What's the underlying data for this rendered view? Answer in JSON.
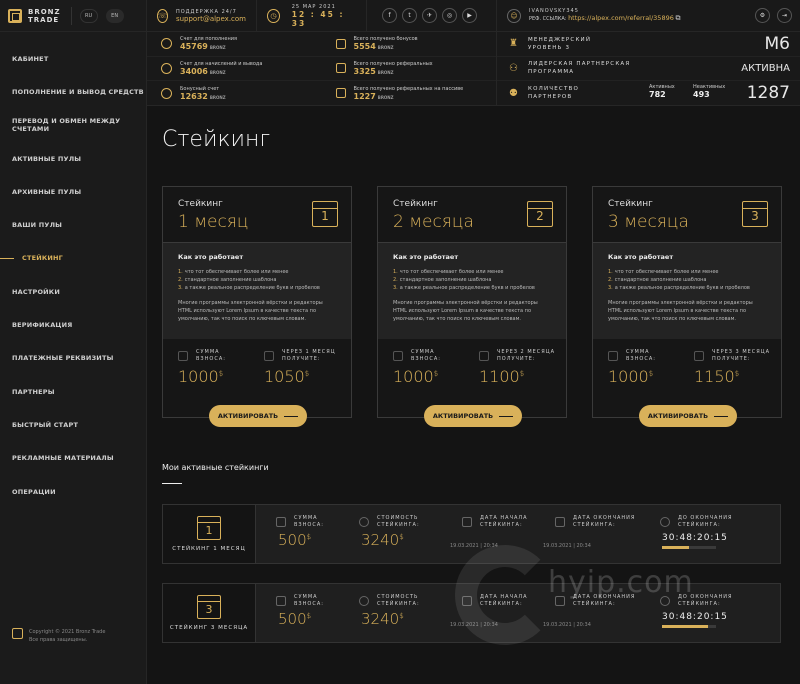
{
  "brand": {
    "line1": "BRONZ",
    "line2": "TRADE"
  },
  "lang": {
    "ru": "RU",
    "en": "EN"
  },
  "menu": [
    "КАБИНЕТ",
    "ПОПОЛНЕНИЕ И ВЫВОД СРЕДСТВ",
    "ПЕРЕВОД И ОБМЕН МЕЖДУ СЧЕТАМИ",
    "АКТИВНЫЕ ПУЛЫ",
    "АРХИВНЫЕ ПУЛЫ",
    "ВАШИ ПУЛЫ",
    "СТЕЙКИНГ",
    "НАСТРОЙКИ",
    "ВЕРИФИКАЦИЯ",
    "ПЛАТЕЖНЫЕ РЕКВИЗИТЫ",
    "ПАРТНЕРЫ",
    "БЫСТРЫЙ СТАРТ",
    "РЕКЛАМНЫЕ МАТЕРИАЛЫ",
    "ОПЕРАЦИИ"
  ],
  "copyright": {
    "line1": "Copyright © 2021 Bronz Trade",
    "line2": "Все права защищены."
  },
  "header": {
    "support_label": "ПОДДЕРЖКА 24/7",
    "support_email": "support@alpex.com",
    "date": "25 МАР 2021",
    "time": "12 : 45 : 33",
    "social": [
      "f",
      "t",
      "✈",
      "◎",
      "▶"
    ],
    "username": "IVANOVSKY345",
    "ref_label": "РЕФ. ССЫЛКА:",
    "ref_link": "https://alpex.com/referral/35896"
  },
  "balances": [
    {
      "label": "Счет для пополнения",
      "value": "45769",
      "unit": "BRONZ"
    },
    {
      "label": "Всего получено бонусов",
      "value": "5554",
      "unit": "BRONZ"
    },
    {
      "label": "Счет для начислений и вывода",
      "value": "34006",
      "unit": "BRONZ"
    },
    {
      "label": "Всего получено реферальных",
      "value": "3325",
      "unit": "BRONZ"
    },
    {
      "label": "Бонусный счет",
      "value": "12632",
      "unit": "BRONZ"
    },
    {
      "label": "Всего получено реферальных на пассиве",
      "value": "1227",
      "unit": "BRONZ"
    }
  ],
  "status": {
    "manager_level_l1": "МЕНЕДЖЕРСКИЙ",
    "manager_level_l2": "УРОВЕНЬ 3",
    "manager_value": "M6",
    "leader_l1": "ЛИДЕРСКАЯ ПАРТНЕРСКАЯ",
    "leader_l2": "ПРОГРАММА",
    "leader_value": "АКТИВНА",
    "partners_l1": "КОЛИЧЕСТВО",
    "partners_l2": "ПАРТНЕРОВ",
    "active_label": "Активных",
    "active_value": "782",
    "inactive_label": "Неактивных",
    "inactive_value": "493",
    "total_value": "1287"
  },
  "page": {
    "title": "Стейкинг",
    "section_title": "Мои активные стейкинги"
  },
  "cards": [
    {
      "kicker": "Стейкинг",
      "months": "1 месяц",
      "num": "1",
      "how_title": "Как это работает",
      "points": [
        "что тот обеспечивает более или менее",
        "стандартное заполнение шаблона",
        "а также реальное распределение букв и пробелов"
      ],
      "text": "Многие программы электронной вёрстки и редакторы HTML используют Lorem Ipsum в качестве текста по умолчанию, так что поиск по ключевым словам.",
      "sum_label_l1": "СУММА",
      "sum_label_l2": "ВЗНОСА:",
      "sum_value": "1000",
      "get_label_l1": "ЧЕРЕЗ 1 МЕСЯЦ",
      "get_label_l2": "ПОЛУЧИТЕ:",
      "get_value": "1050",
      "currency": "$",
      "button": "АКТИВИРОВАТЬ"
    },
    {
      "kicker": "Стейкинг",
      "months": "2 месяца",
      "num": "2",
      "how_title": "Как это работает",
      "points": [
        "что тот обеспечивает более или менее",
        "стандартное заполнение шаблона",
        "а также реальное распределение букв и пробелов"
      ],
      "text": "Многие программы электронной вёрстки и редакторы HTML используют Lorem Ipsum в качестве текста по умолчанию, так что поиск по ключевым словам.",
      "sum_label_l1": "СУММА",
      "sum_label_l2": "ВЗНОСА:",
      "sum_value": "1000",
      "get_label_l1": "ЧЕРЕЗ 2 МЕСЯЦА",
      "get_label_l2": "ПОЛУЧИТЕ:",
      "get_value": "1100",
      "currency": "$",
      "button": "АКТИВИРОВАТЬ"
    },
    {
      "kicker": "Стейкинг",
      "months": "3 месяца",
      "num": "3",
      "how_title": "Как это работает",
      "points": [
        "что тот обеспечивает более или менее",
        "стандартное заполнение шаблона",
        "а также реальное распределение букв и пробелов"
      ],
      "text": "Многие программы электронной вёрстки и редакторы HTML используют Lorem Ipsum в качестве текста по умолчанию, так что поиск по ключевым словам.",
      "sum_label_l1": "СУММА",
      "sum_label_l2": "ВЗНОСА:",
      "sum_value": "1000",
      "get_label_l1": "ЧЕРЕЗ 3 МЕСЯЦА",
      "get_label_l2": "ПОЛУЧИТЕ:",
      "get_value": "1150",
      "currency": "$",
      "button": "АКТИВИРОВАТЬ"
    }
  ],
  "active": [
    {
      "num": "1",
      "name": "СТЕЙКИНГ 1 МЕСЯЦ",
      "sum_l1": "СУММА",
      "sum_l2": "ВЗНОСА:",
      "sum": "500",
      "cost_l1": "СТОИМОСТЬ",
      "cost_l2": "СТЕЙКИНГА:",
      "cost": "3240",
      "start_l1": "ДАТА НАЧАЛА",
      "start_l2": "СТЕЙКИНГА:",
      "start": "19.03.2021 | 20:34",
      "end_l1": "ДАТА ОКОНЧАНИЯ",
      "end_l2": "СТЕЙКИНГА:",
      "end": "19.03.2021 | 20:34",
      "left_l1": "ДО ОКОНЧАНИЯ",
      "left_l2": "СТЕЙКИНГА:",
      "timer": "30:48:20:15",
      "progress": 0.5,
      "currency": "$"
    },
    {
      "num": "3",
      "name": "СТЕЙКИНГ 3 МЕСЯЦА",
      "sum_l1": "СУММА",
      "sum_l2": "ВЗНОСА:",
      "sum": "500",
      "cost_l1": "СТОИМОСТЬ",
      "cost_l2": "СТЕЙКИНГА:",
      "cost": "3240",
      "start_l1": "ДАТА НАЧАЛА",
      "start_l2": "СТЕЙКИНГА:",
      "start": "19.03.2021 | 20:34",
      "end_l1": "ДАТА ОКОНЧАНИЯ",
      "end_l2": "СТЕЙКИНГА:",
      "end": "19.03.2021 | 20:34",
      "left_l1": "ДО ОКОНЧАНИЯ",
      "left_l2": "СТЕЙКИНГА:",
      "timer": "30:48:20:15",
      "progress": 0.85,
      "currency": "$"
    }
  ],
  "watermark": "hyip.com"
}
